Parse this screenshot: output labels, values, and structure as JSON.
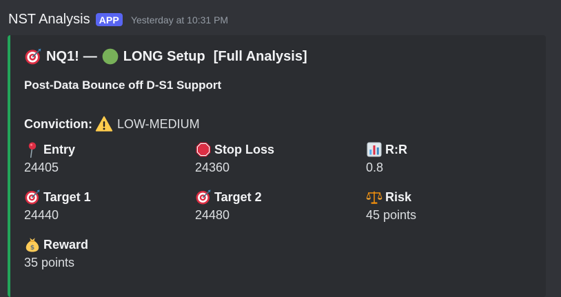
{
  "message": {
    "author": "NST Analysis",
    "badge": "APP",
    "timestamp": "Yesterday at 10:31 PM"
  },
  "embed": {
    "accent_color": "#23a55a",
    "title": {
      "symbol": "NQ1!",
      "dash": "—",
      "setup": "LONG Setup",
      "suffix": "[Full Analysis]",
      "icons": [
        "target-icon",
        "green-circle-icon"
      ]
    },
    "description": "Post-Data Bounce off D-S1 Support",
    "conviction": {
      "label": "Conviction:",
      "icon": "warning-icon",
      "value": "LOW-MEDIUM"
    },
    "fields": [
      {
        "icon": "pushpin-icon",
        "name": "Entry",
        "value": "24405"
      },
      {
        "icon": "stop-sign-icon",
        "name": "Stop Loss",
        "value": "24360"
      },
      {
        "icon": "bar-chart-icon",
        "name": "R:R",
        "value": "0.8"
      },
      {
        "icon": "target-icon",
        "name": "Target 1",
        "value": "24440"
      },
      {
        "icon": "target-icon",
        "name": "Target 2",
        "value": "24480"
      },
      {
        "icon": "scales-icon",
        "name": "Risk",
        "value": "45 points"
      },
      {
        "icon": "money-bag-icon",
        "name": "Reward",
        "value": "35 points"
      }
    ]
  },
  "colors": {
    "background": "#313338",
    "embed_background": "#2b2d31",
    "badge": "#5865f2",
    "timestamp": "#949ba4"
  }
}
